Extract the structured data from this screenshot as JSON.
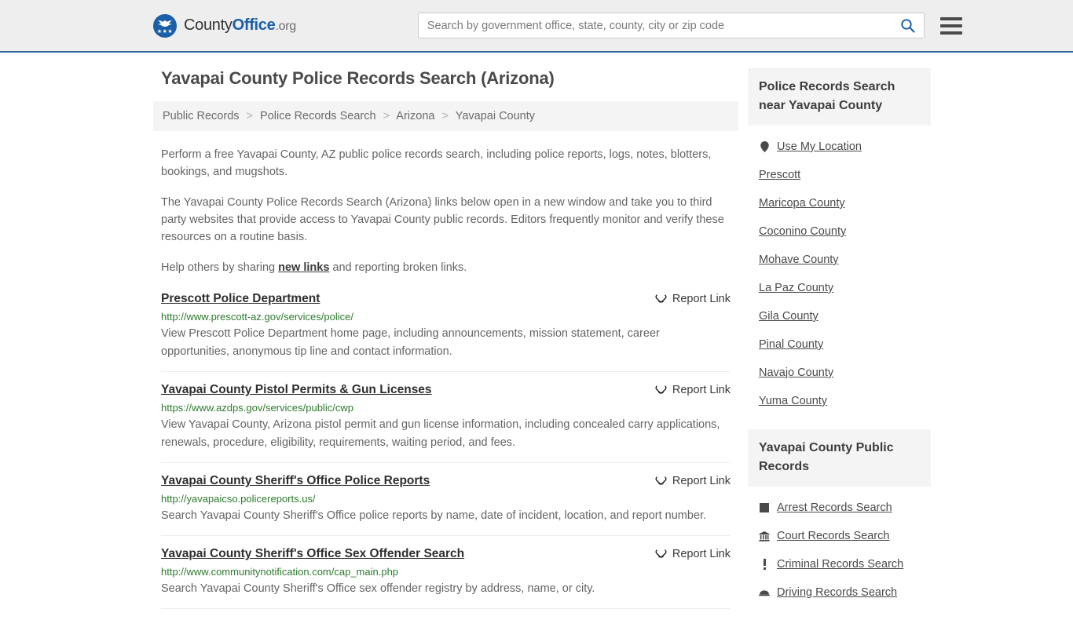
{
  "header": {
    "brand": {
      "county": "County",
      "office": "Office",
      "tld": ".org",
      "logo_icon": "eagle-seal-icon",
      "stars": "★★★"
    },
    "search": {
      "placeholder": "Search by government office, state, county, city or zip code",
      "value": "",
      "search_icon": "magnifier-icon"
    },
    "menu_icon": "hamburger-menu-icon"
  },
  "main": {
    "title": "Yavapai County Police Records Search (Arizona)",
    "breadcrumb": [
      "Public Records",
      "Police Records Search",
      "Arizona",
      "Yavapai County"
    ],
    "breadcrumb_separator": ">",
    "intro": {
      "p1": "Perform a free Yavapai County, AZ public police records search, including police reports, logs, notes, blotters, bookings, and mugshots.",
      "p2": "The Yavapai County Police Records Search (Arizona) links below open in a new window and take you to third party websites that provide access to Yavapai County public records. Editors frequently monitor and verify these resources on a routine basis.",
      "p3_before": "Help others by sharing ",
      "p3_link": "new links",
      "p3_after": " and reporting broken links."
    },
    "report_link_label": "Report Link",
    "report_link_icon": "broken-chain-icon",
    "results": [
      {
        "title": "Prescott Police Department",
        "url": "http://www.prescott-az.gov/services/police/",
        "description": "View Prescott Police Department home page, including announcements, mission statement, career opportunities, anonymous tip line and contact information."
      },
      {
        "title": "Yavapai County Pistol Permits & Gun Licenses",
        "url": "https://www.azdps.gov/services/public/cwp",
        "description": "View Yavapai County, Arizona pistol permit and gun license information, including concealed carry applications, renewals, procedure, eligibility, requirements, waiting period, and fees."
      },
      {
        "title": "Yavapai County Sheriff's Office Police Reports",
        "url": "http://yavapaicso.policereports.us/",
        "description": "Search Yavapai County Sheriff's Office police reports by name, date of incident, location, and report number."
      },
      {
        "title": "Yavapai County Sheriff's Office Sex Offender Search",
        "url": "http://www.communitynotification.com/cap_main.php",
        "description": "Search Yavapai County Sheriff's Office sex offender registry by address, name, or city."
      }
    ]
  },
  "sidebar": {
    "nearby": {
      "heading": "Police Records Search near Yavapai County",
      "items": [
        {
          "label": "Use My Location",
          "icon": "map-pin-icon"
        },
        {
          "label": "Prescott",
          "icon": ""
        },
        {
          "label": "Maricopa County",
          "icon": ""
        },
        {
          "label": "Coconino County",
          "icon": ""
        },
        {
          "label": "Mohave County",
          "icon": ""
        },
        {
          "label": "La Paz County",
          "icon": ""
        },
        {
          "label": "Gila County",
          "icon": ""
        },
        {
          "label": "Pinal County",
          "icon": ""
        },
        {
          "label": "Navajo County",
          "icon": ""
        },
        {
          "label": "Yuma County",
          "icon": ""
        }
      ]
    },
    "public_records": {
      "heading": "Yavapai County Public Records",
      "items": [
        {
          "label": "Arrest Records Search",
          "icon": "building-square-icon"
        },
        {
          "label": "Court Records Search",
          "icon": "courthouse-icon"
        },
        {
          "label": "Criminal Records Search",
          "icon": "exclamation-icon"
        },
        {
          "label": "Driving Records Search",
          "icon": "car-icon"
        }
      ]
    }
  },
  "colors": {
    "accent": "#31679c",
    "brand_blue": "#1a5fa8",
    "header_bg": "#eeeeee",
    "panel_bg": "#f4f4f4",
    "url_green": "#2d7a2d",
    "body_text": "#646464"
  }
}
